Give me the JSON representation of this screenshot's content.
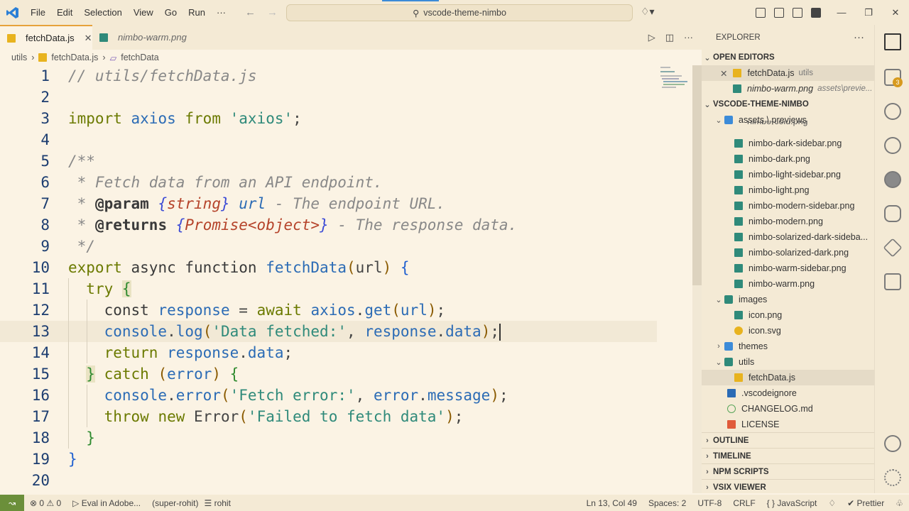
{
  "titlebar": {
    "menu": [
      "File",
      "Edit",
      "Selection",
      "View",
      "Go",
      "Run",
      "···"
    ],
    "search_text": "vscode-theme-nimbo",
    "copilot_icon": "copilot-icon"
  },
  "tabs": [
    {
      "label": "fetchData.js",
      "active": true
    },
    {
      "label": "nimbo-warm.png",
      "active": false
    }
  ],
  "breadcrumb": {
    "folder": "utils",
    "file": "fetchData.js",
    "symbol": "fetchData"
  },
  "editor": {
    "line_numbers": [
      "1",
      "2",
      "3",
      "4",
      "5",
      "6",
      "7",
      "8",
      "9",
      "10",
      "11",
      "12",
      "13",
      "14",
      "15",
      "16",
      "17",
      "18",
      "19",
      "20"
    ],
    "current_line": 13
  },
  "explorer": {
    "title": "EXPLORER",
    "open_editors_label": "OPEN EDITORS",
    "open_editors": [
      {
        "name": "fetchData.js",
        "desc": "utils"
      },
      {
        "name": "nimbo-warm.png",
        "desc": "assets\\previe..."
      }
    ],
    "project_label": "VSCODE-THEME-NIMBO",
    "assets_folder": "assets \\ previews",
    "preview_files": [
      "nimbo-cold.png",
      "nimbo-dark-sidebar.png",
      "nimbo-dark.png",
      "nimbo-light-sidebar.png",
      "nimbo-light.png",
      "nimbo-modern-sidebar.png",
      "nimbo-modern.png",
      "nimbo-solarized-dark-sideba...",
      "nimbo-solarized-dark.png",
      "nimbo-warm-sidebar.png",
      "nimbo-warm.png"
    ],
    "images_folder": "images",
    "images_files": [
      "icon.png",
      "icon.svg"
    ],
    "themes_folder": "themes",
    "utils_folder": "utils",
    "utils_files": [
      "fetchData.js"
    ],
    "root_files": [
      ".vscodeignore",
      "CHANGELOG.md",
      "LICENSE"
    ],
    "bottom_sections": [
      "OUTLINE",
      "TIMELINE",
      "NPM SCRIPTS",
      "VSIX VIEWER"
    ]
  },
  "activity": {
    "extensions_badge": "3"
  },
  "statusbar": {
    "problems": "⊗ 0 ⚠ 0",
    "eval": "▷ Eval in Adobe...",
    "user": "(super-rohit)",
    "terminal": "☰ rohit",
    "position": "Ln 13, Col 49",
    "spaces": "Spaces: 2",
    "encoding": "UTF-8",
    "eol": "CRLF",
    "language": "{ } JavaScript",
    "prettier": "✔ Prettier"
  },
  "colors": {
    "accent": "#e6a23c",
    "remote": "#6b8f3a",
    "folder": "#3c8bd8"
  }
}
